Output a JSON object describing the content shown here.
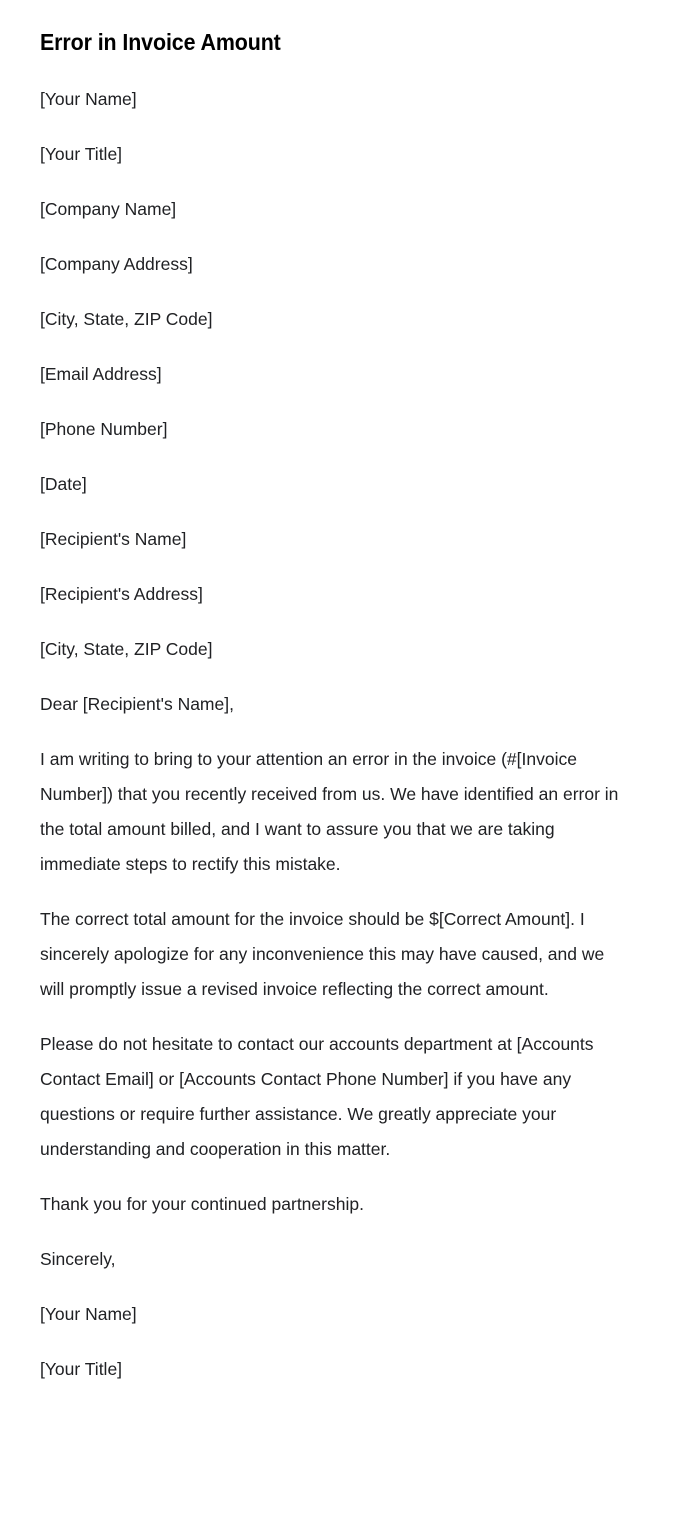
{
  "document": {
    "title": "Error in Invoice Amount",
    "text_color": "#202124",
    "title_color": "#000000",
    "background_color": "#ffffff",
    "blocks": [
      {
        "name": "sender-name-placeholder",
        "text": "[Your Name]"
      },
      {
        "name": "sender-title-placeholder",
        "text": "[Your Title]"
      },
      {
        "name": "company-name-placeholder",
        "text": "[Company Name]"
      },
      {
        "name": "company-address-placeholder",
        "text": "[Company Address]"
      },
      {
        "name": "sender-city-state-zip-placeholder",
        "text": "[City, State, ZIP Code]"
      },
      {
        "name": "email-address-placeholder",
        "text": "[Email Address]"
      },
      {
        "name": "phone-number-placeholder",
        "text": "[Phone Number]"
      },
      {
        "name": "date-placeholder",
        "text": "[Date]"
      },
      {
        "name": "recipient-name-placeholder",
        "text": "[Recipient's Name]"
      },
      {
        "name": "recipient-address-placeholder",
        "text": "[Recipient's Address]"
      },
      {
        "name": "recipient-city-state-zip-placeholder",
        "text": "[City, State, ZIP Code]"
      },
      {
        "name": "salutation",
        "text": "Dear [Recipient's Name],"
      },
      {
        "name": "body-paragraph-1",
        "text": "I am writing to bring to your attention an error in the invoice (#[Invoice Number]) that you recently received from us. We have identified an error in the total amount billed, and I want to assure you that we are taking immediate steps to rectify this mistake."
      },
      {
        "name": "body-paragraph-2",
        "text": "The correct total amount for the invoice should be $[Correct Amount]. I sincerely apologize for any inconvenience this may have caused, and we will promptly issue a revised invoice reflecting the correct amount."
      },
      {
        "name": "body-paragraph-3",
        "text": "Please do not hesitate to contact our accounts department at [Accounts Contact Email] or [Accounts Contact Phone Number] if you have any questions or require further assistance. We greatly appreciate your understanding and cooperation in this matter."
      },
      {
        "name": "closing-thanks",
        "text": "Thank you for your continued partnership."
      },
      {
        "name": "closing-salutation",
        "text": "Sincerely,"
      },
      {
        "name": "signature-name-placeholder",
        "text": "[Your Name]"
      },
      {
        "name": "signature-title-placeholder",
        "text": "[Your Title]"
      }
    ]
  }
}
